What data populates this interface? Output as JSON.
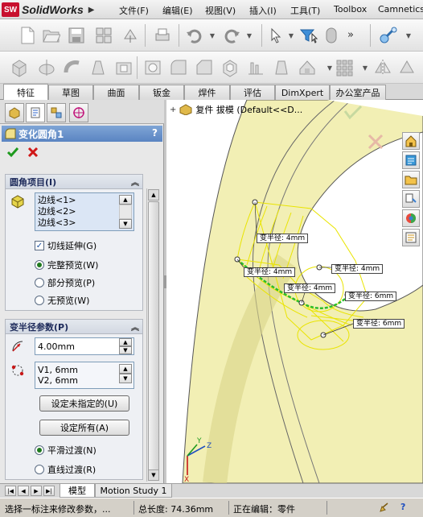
{
  "app": {
    "logo_text": "SW",
    "brand": "SolidWorks"
  },
  "menu": [
    {
      "label": "文件(F)"
    },
    {
      "label": "编辑(E)"
    },
    {
      "label": "视图(V)"
    },
    {
      "label": "插入(I)"
    },
    {
      "label": "工具(T)"
    },
    {
      "label": "Toolbox"
    },
    {
      "label": "Camnetics"
    }
  ],
  "toolbar1": {
    "overflow": "»",
    "icons": [
      "new-document-icon",
      "open-icon",
      "save-icon",
      "print-preview-icon",
      "rebuild-icon",
      "print-icon",
      "undo-icon",
      "redo-icon",
      "select-icon",
      "selection-filter-icon",
      "options-icon"
    ]
  },
  "toolbar2": {
    "icons": [
      "extrude-boss-icon",
      "revolve-icon",
      "sweep-icon",
      "loft-icon",
      "extrude-cut-icon",
      "revolve-cut-icon",
      "fillet-icon",
      "chamfer-icon",
      "shell-icon",
      "rib-icon",
      "draft-icon",
      "linear-pattern-icon",
      "mirror-icon"
    ]
  },
  "command_tabs": [
    {
      "label": "特征",
      "active": true
    },
    {
      "label": "草图"
    },
    {
      "label": "曲面"
    },
    {
      "label": "钣金"
    },
    {
      "label": "焊件"
    },
    {
      "label": "评估"
    },
    {
      "label": "DimXpert"
    },
    {
      "label": "办公室产品"
    }
  ],
  "property_manager": {
    "title": "变化圆角1",
    "help": "?",
    "fillet_items": {
      "header": "圆角项目(I)",
      "edges": [
        "边线<1>",
        "边线<2>",
        "边线<3>"
      ],
      "tangent_propagation": "切线延伸(G)",
      "preview_options": [
        {
          "label": "完整预览(W)",
          "selected": true
        },
        {
          "label": "部分预览(P)",
          "selected": false
        },
        {
          "label": "无预览(W)",
          "selected": false
        }
      ]
    },
    "variable_radius": {
      "header": "变半径参数(P)",
      "radius_value": "4.00mm",
      "vertices": [
        "V1, 6mm",
        "V2, 6mm"
      ],
      "set_unassigned_button": "设定未指定的(U)",
      "set_all_button": "设定所有(A)",
      "smooth_transition": "平滑过渡(N)",
      "straight_transition": "直线过渡(R)"
    }
  },
  "viewport": {
    "breadcrumb": "复件 拔模  (Default<<D...",
    "radius_callouts": [
      {
        "text": "变半径: 4mm"
      },
      {
        "text": "变半径: 4mm"
      },
      {
        "text": "变半径: 4mm"
      },
      {
        "text": "变半径: 4mm"
      },
      {
        "text": "变半径: 6mm"
      },
      {
        "text": "变半径: 6mm"
      }
    ]
  },
  "bottom_tabs": [
    {
      "label": "模型",
      "active": true
    },
    {
      "label": "Motion Study 1",
      "active": false
    }
  ],
  "status_bar": {
    "message": "选择一标注来修改参数，...",
    "total_length": "总长度: 74.36mm",
    "editing": "正在编辑：零件"
  },
  "colors": {
    "model_surface": "#f2efb4",
    "model_shadow": "#e6e397",
    "fillet_edge": "#2bbd2b",
    "preview_mesh": "#e9e400",
    "title_bar": "#5a84c2"
  }
}
